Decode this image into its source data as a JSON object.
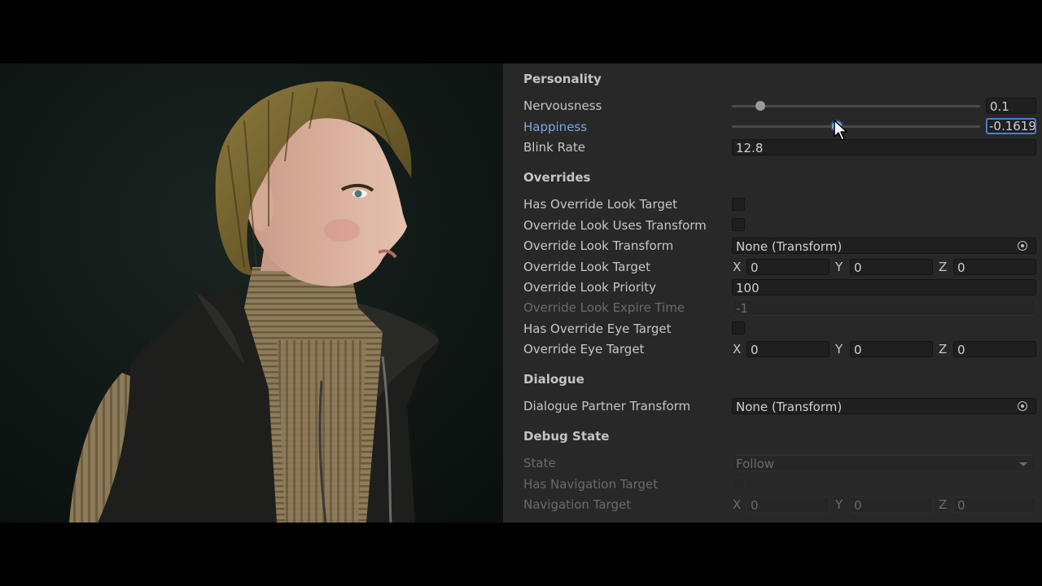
{
  "viewport": {
    "subject": "3D character render"
  },
  "inspector": {
    "personality": {
      "title": "Personality",
      "nervousness": {
        "label": "Nervousness",
        "value": "0.1",
        "slider_fraction": 0.1
      },
      "happiness": {
        "label": "Happiness",
        "value": "-0.16191",
        "slider_fraction": 0.42
      },
      "blink_rate": {
        "label": "Blink Rate",
        "value": "12.8"
      }
    },
    "overrides": {
      "title": "Overrides",
      "has_override_look_target": {
        "label": "Has Override Look Target"
      },
      "override_look_uses_transform": {
        "label": "Override Look Uses Transform"
      },
      "override_look_transform": {
        "label": "Override Look Transform",
        "value": "None (Transform)"
      },
      "override_look_target": {
        "label": "Override Look Target",
        "x": "0",
        "y": "0",
        "z": "0"
      },
      "override_look_priority": {
        "label": "Override Look Priority",
        "value": "100"
      },
      "override_look_expire_time": {
        "label": "Override Look Expire Time",
        "value": "-1"
      },
      "has_override_eye_target": {
        "label": "Has Override Eye Target"
      },
      "override_eye_target": {
        "label": "Override Eye Target",
        "x": "0",
        "y": "0",
        "z": "0"
      }
    },
    "dialogue": {
      "title": "Dialogue",
      "partner_transform": {
        "label": "Dialogue Partner Transform",
        "value": "None (Transform)"
      }
    },
    "debug_state": {
      "title": "Debug State",
      "state": {
        "label": "State",
        "value": "Follow"
      },
      "has_navigation_target": {
        "label": "Has Navigation Target"
      },
      "navigation_target": {
        "label": "Navigation Target",
        "x": "0",
        "y": "0",
        "z": "0"
      }
    },
    "axes": {
      "x": "X",
      "y": "Y",
      "z": "Z"
    }
  },
  "colors": {
    "panel_bg": "#282828",
    "accent": "#7fa6e0",
    "focus_border": "#4a7fc4"
  }
}
